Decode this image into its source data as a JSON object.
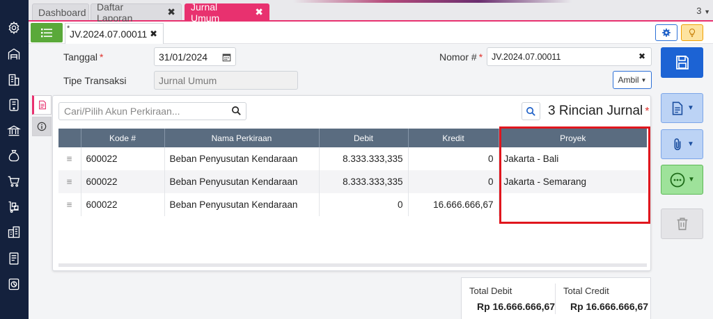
{
  "top_tabs": [
    {
      "label": "Dashboard"
    },
    {
      "label": "Daftar Laporan"
    },
    {
      "label": "Jurnal Umum"
    }
  ],
  "tab_count": "3",
  "doc_tab": {
    "modified_mark": "*",
    "label": "JV.2024.07.00011"
  },
  "form": {
    "tanggal_label": "Tanggal",
    "tanggal_value": "31/01/2024",
    "nomor_label": "Nomor #",
    "nomor_value": "JV.2024.07.00011",
    "tipe_label": "Tipe Transaksi",
    "tipe_value": "Jurnal Umum",
    "required_mark": "*",
    "ambil_label": "Ambil"
  },
  "rincian": {
    "search_placeholder": "Cari/Pilih Akun Perkiraan...",
    "title": "3 Rincian Jurnal",
    "required_mark": "*"
  },
  "table": {
    "headers": [
      "Kode #",
      "Nama Perkiraan",
      "Debit",
      "Kredit",
      "Proyek"
    ],
    "rows": [
      {
        "kode": "600022",
        "nama": "Beban Penyusutan Kendaraan",
        "debit": "8.333.333,335",
        "kredit": "0",
        "proyek": "Jakarta - Bali"
      },
      {
        "kode": "600022",
        "nama": "Beban Penyusutan Kendaraan",
        "debit": "8.333.333,335",
        "kredit": "0",
        "proyek": "Jakarta - Semarang"
      },
      {
        "kode": "600022",
        "nama": "Beban Penyusutan Kendaraan",
        "debit": "0",
        "kredit": "16.666.666,67",
        "proyek": ""
      }
    ]
  },
  "totals": {
    "debit_label": "Total Debit",
    "debit_value": "Rp 16.666.666,67",
    "credit_label": "Total Credit",
    "credit_value": "Rp 16.666.666,67"
  },
  "colors": {
    "accent": "#e8316f",
    "sidebar": "#14213d",
    "header": "#5a6c80",
    "highlight": "#e0161e",
    "save": "#1c63d4"
  }
}
